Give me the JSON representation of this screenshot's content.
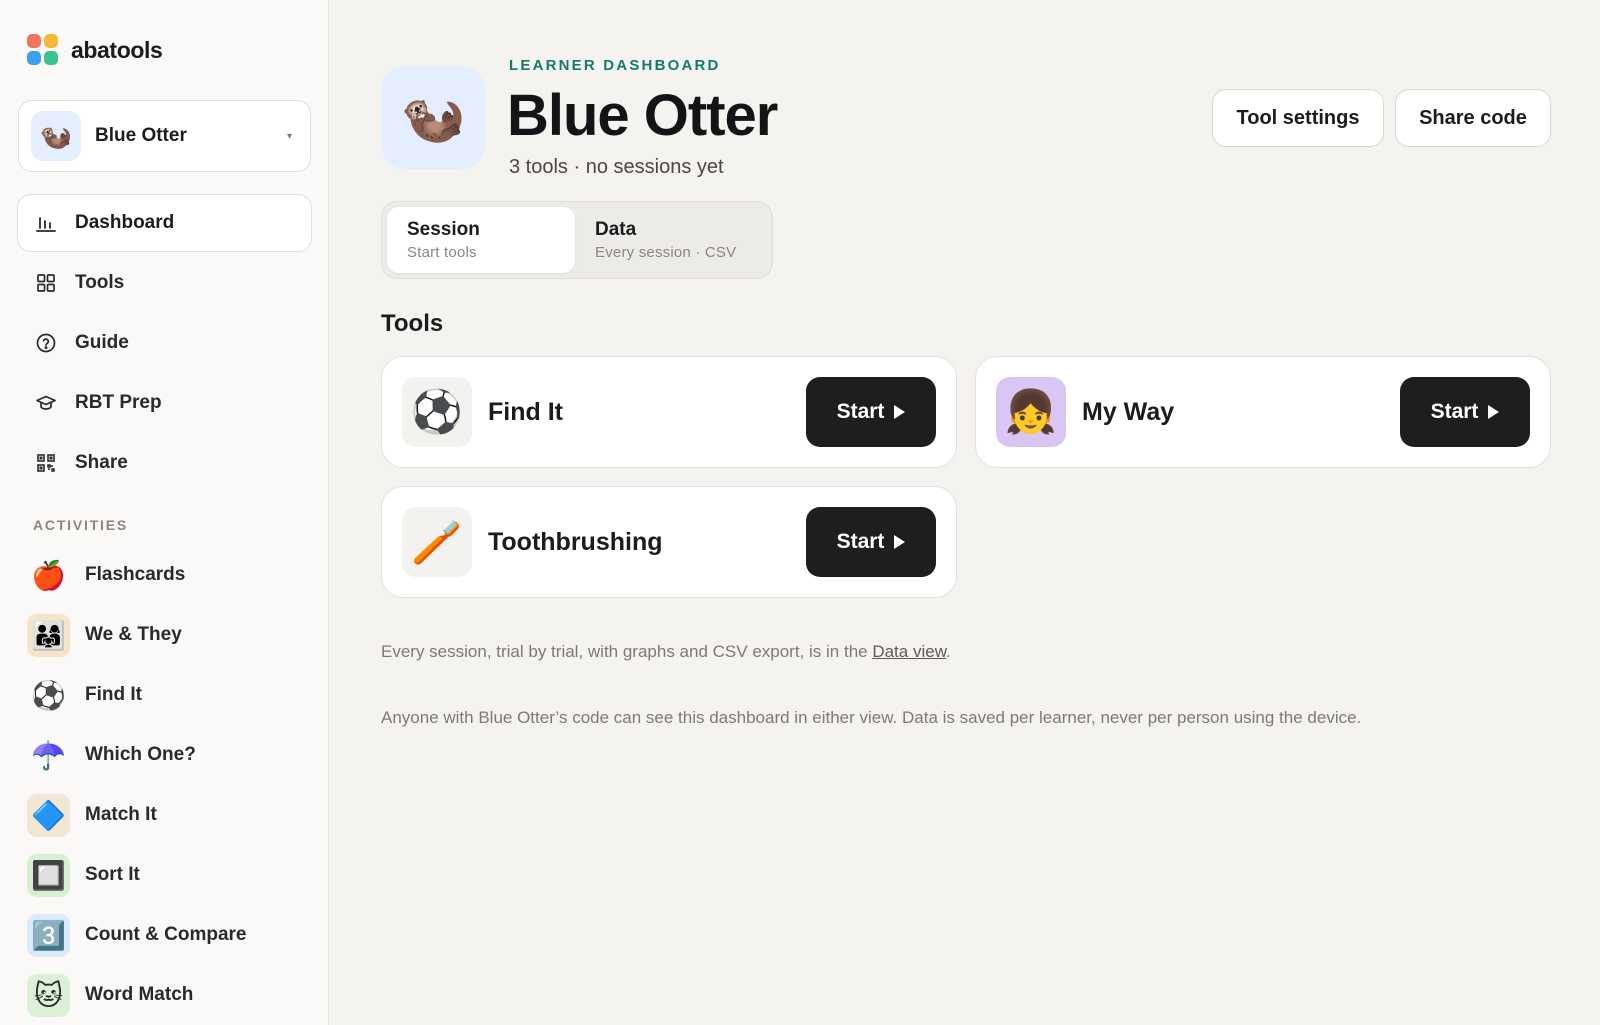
{
  "brand": {
    "name": "abatools",
    "logo_colors": [
      "#f2745f",
      "#f5b93a",
      "#3aa0f0",
      "#3cc08c"
    ]
  },
  "learner": {
    "name": "Blue Otter",
    "avatar": "🦦",
    "caret": "▾"
  },
  "nav": [
    {
      "label": "Dashboard",
      "icon": "bar-chart-icon",
      "active": true
    },
    {
      "label": "Tools",
      "icon": "grid-icon"
    },
    {
      "label": "Guide",
      "icon": "help-circle-icon"
    },
    {
      "label": "RBT Prep",
      "icon": "graduation-cap-icon"
    },
    {
      "label": "Share",
      "icon": "qr-code-icon"
    }
  ],
  "activities_label": "ACTIVITIES",
  "activities": [
    {
      "label": "Flashcards",
      "icon": "apple-icon",
      "glyph": "🍎",
      "bg": "transparent"
    },
    {
      "label": "We & They",
      "icon": "people-icon",
      "glyph": "👨‍👩‍👧",
      "bg": "#f6e3c8"
    },
    {
      "label": "Find It",
      "icon": "soccer-ball-icon",
      "glyph": "⚽",
      "bg": "transparent"
    },
    {
      "label": "Which One?",
      "icon": "umbrella-icon",
      "glyph": "☂️",
      "bg": "transparent"
    },
    {
      "label": "Match It",
      "icon": "shapes-icon",
      "glyph": "🔷",
      "bg": "#f4e6d4"
    },
    {
      "label": "Sort It",
      "icon": "blocks-icon",
      "glyph": "🔲",
      "bg": "#d6f0d2"
    },
    {
      "label": "Count & Compare",
      "icon": "number-card-icon",
      "glyph": "3️⃣",
      "bg": "#dcebfb"
    },
    {
      "label": "Word Match",
      "icon": "word-picture-icon",
      "glyph": "🐱",
      "bg": "#dcf0d8"
    }
  ],
  "header": {
    "eyebrow": "LEARNER DASHBOARD",
    "title": "Blue Otter",
    "subtitle": "3 tools · no sessions yet",
    "settings_label": "Tool settings",
    "share_label": "Share code"
  },
  "views": [
    {
      "title": "Session",
      "subtitle": "Start tools",
      "active": true
    },
    {
      "title": "Data",
      "subtitle": "Every session · CSV",
      "active": false
    }
  ],
  "tools_heading": "Tools",
  "tools": [
    {
      "name": "Find It",
      "icon": "soccer-ball-icon",
      "glyph": "⚽",
      "bg": "#f4f2ee",
      "start_label": "Start"
    },
    {
      "name": "My Way",
      "icon": "girl-portrait-icon",
      "glyph": "👧",
      "bg": "#d9c6f2",
      "start_label": "Start"
    },
    {
      "name": "Toothbrushing",
      "icon": "toothbrush-icon",
      "glyph": "🪥",
      "bg": "#f4f2ee",
      "start_label": "Start"
    }
  ],
  "notes": {
    "data_prefix": "Every session, trial by trial, with graphs and CSV export, is in the ",
    "data_link": "Data view",
    "data_suffix": ".",
    "privacy": "Anyone with Blue Otter’s code can see this dashboard in either view. Data is saved per learner, never per person using the device."
  }
}
